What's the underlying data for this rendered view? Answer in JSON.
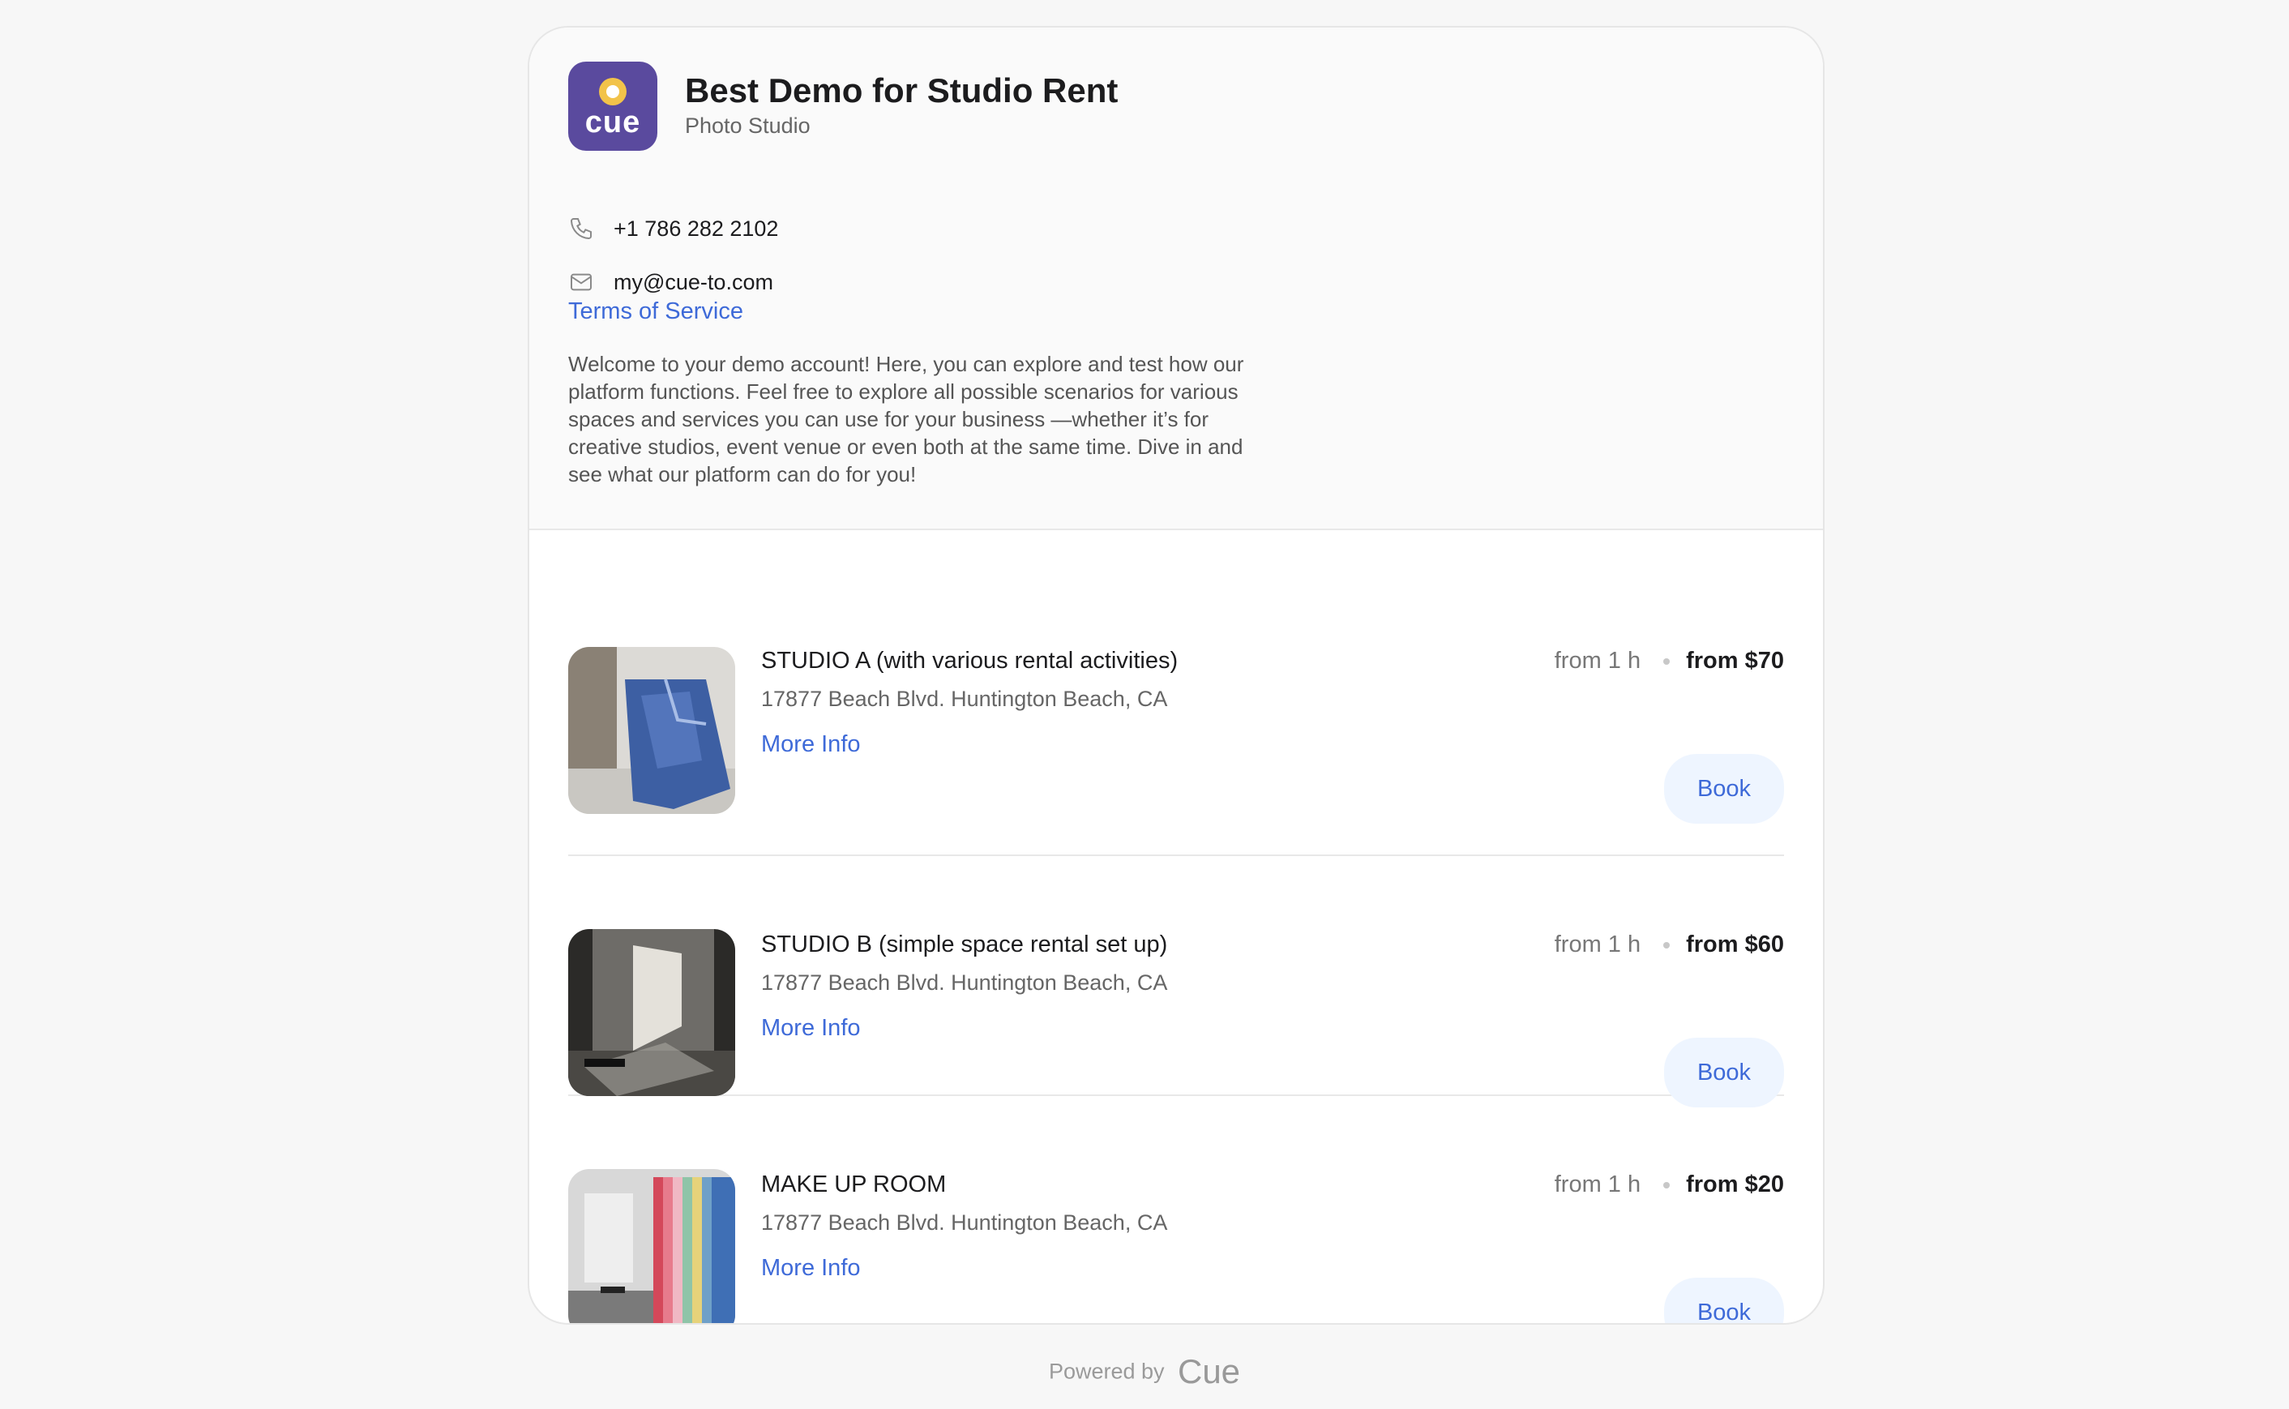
{
  "business": {
    "name": "Best Demo for Studio Rent",
    "category": "Photo Studio",
    "logo_text": "cue",
    "phone": "+1 786 282 2102",
    "email": "my@cue-to.com",
    "tos_label": "Terms of Service",
    "description": "Welcome to your demo account! Here, you can explore and test how our platform functions. Feel free to explore all possible scenarios for various spaces and services you can use for your business —whether it’s for creative studios, event venue or even both at the same time. Dive in and see what our platform can do for you!"
  },
  "services": [
    {
      "name": "STUDIO A (with various rental activities)",
      "address": "17877 Beach Blvd. Huntington Beach, CA",
      "more_label": "More Info",
      "duration": "from 1 h",
      "price": "from $70",
      "book_label": "Book"
    },
    {
      "name": "STUDIO B (simple space rental set up)",
      "address": "17877 Beach Blvd. Huntington Beach, CA",
      "more_label": "More Info",
      "duration": "from 1 h",
      "price": "from $60",
      "book_label": "Book"
    },
    {
      "name": "MAKE UP ROOM",
      "address": "17877 Beach Blvd. Huntington Beach, CA",
      "more_label": "More Info",
      "duration": "from 1 h",
      "price": "from $20",
      "book_label": "Book"
    }
  ],
  "footer": {
    "powered_by": "Powered by",
    "brand": "Cue"
  },
  "colors": {
    "accent": "#3e6ad8",
    "logo_bg": "#5a4a9e",
    "book_bg": "#eef5ff"
  }
}
